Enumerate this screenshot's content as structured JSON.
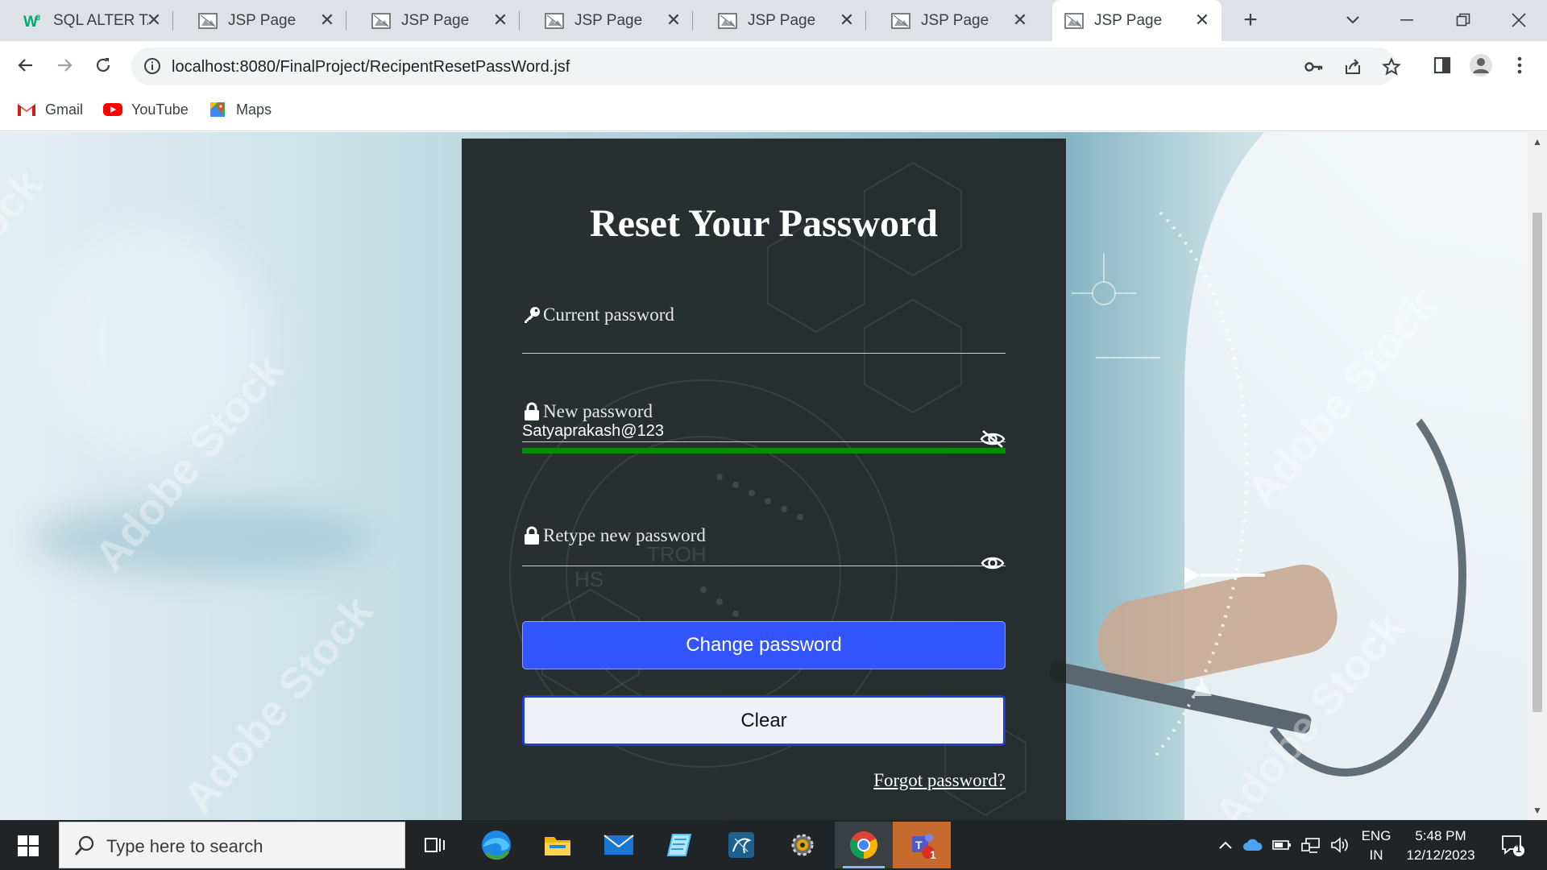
{
  "browser": {
    "tabs": [
      {
        "title": "SQL ALTER TAI",
        "icon": "w3schools-icon",
        "active": false
      },
      {
        "title": "JSP Page",
        "icon": "page-icon",
        "active": false
      },
      {
        "title": "JSP Page",
        "icon": "page-icon",
        "active": false
      },
      {
        "title": "JSP Page",
        "icon": "page-icon",
        "active": false
      },
      {
        "title": "JSP Page",
        "icon": "page-icon",
        "active": false
      },
      {
        "title": "JSP Page",
        "icon": "page-icon",
        "active": false
      },
      {
        "title": "JSP Page",
        "icon": "page-icon",
        "active": true
      }
    ],
    "url": "localhost:8080/FinalProject/RecipentResetPassWord.jsf",
    "bookmarks": [
      {
        "label": "Gmail",
        "icon": "gmail-icon"
      },
      {
        "label": "YouTube",
        "icon": "youtube-icon"
      },
      {
        "label": "Maps",
        "icon": "maps-icon"
      }
    ]
  },
  "form": {
    "title": "Reset Your Password",
    "current_password": {
      "label": "Current password",
      "value": ""
    },
    "new_password": {
      "label": "New password",
      "value": "Satyaprakash@123",
      "strength_color": "#0a8a0a"
    },
    "retype_password": {
      "label": "Retype new password",
      "value": ""
    },
    "change_button": "Change password",
    "clear_button": "Clear",
    "forgot_link": "Forgot password?",
    "accent_color": "#3355ff"
  },
  "taskbar": {
    "search_placeholder": "Type here to search",
    "language": "ENG",
    "region": "IN",
    "time": "5:48 PM",
    "date": "12/12/2023",
    "notification_count": "1",
    "teams_badge": "1"
  }
}
